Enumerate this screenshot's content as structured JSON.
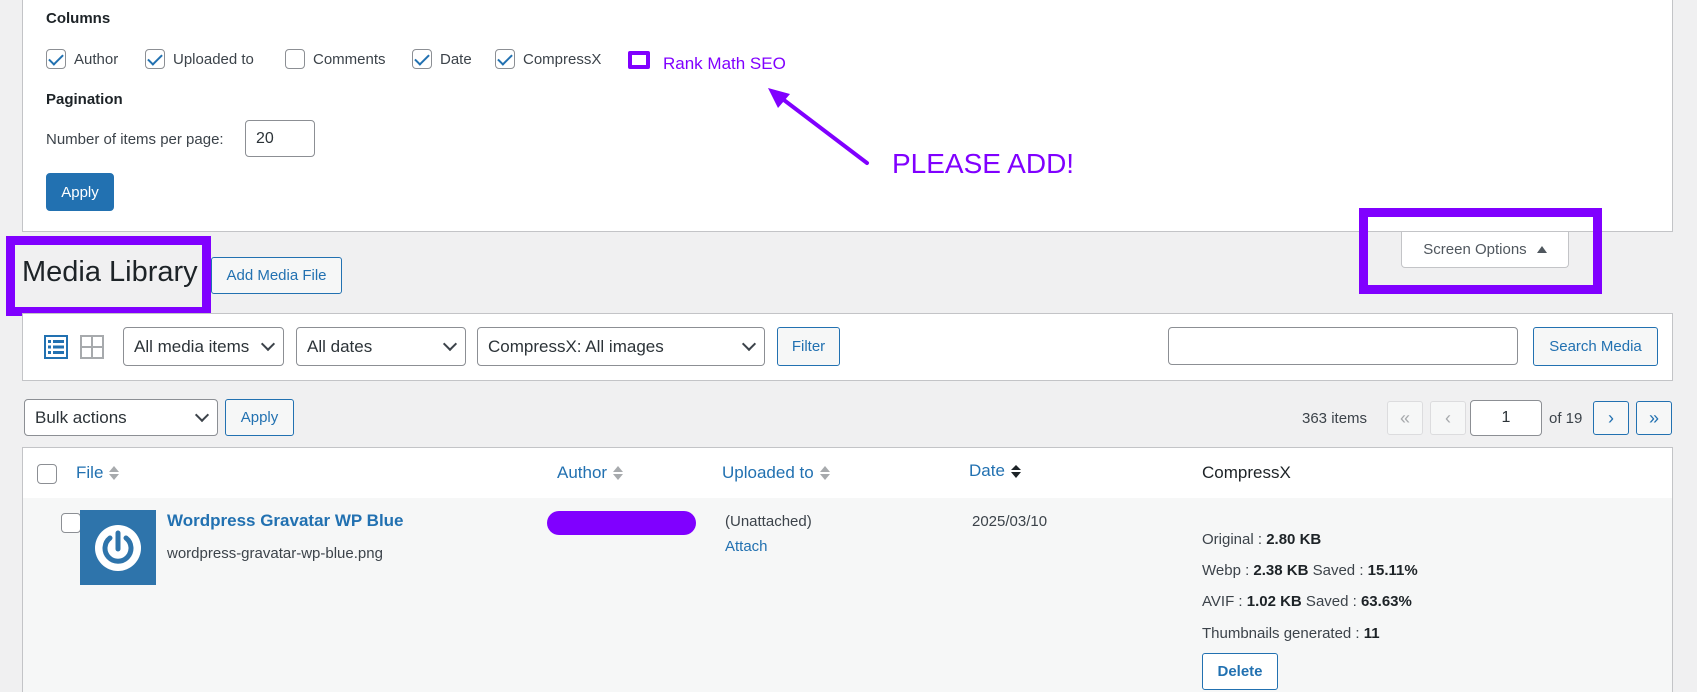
{
  "screen_options": {
    "columns_heading": "Columns",
    "columns": [
      {
        "label": "Author",
        "checked": true
      },
      {
        "label": "Uploaded to",
        "checked": true
      },
      {
        "label": "Comments",
        "checked": false
      },
      {
        "label": "Date",
        "checked": true
      },
      {
        "label": "CompressX",
        "checked": true
      }
    ],
    "rank_math_label": "Rank Math SEO",
    "pagination_heading": "Pagination",
    "items_per_page_label": "Number of items per page:",
    "items_per_page_value": "20",
    "apply_label": "Apply",
    "toggle_label": "Screen Options"
  },
  "annotation": {
    "text": "PLEASE ADD!",
    "color": "#8000ff"
  },
  "header": {
    "title": "Media Library",
    "add_button": "Add Media File"
  },
  "toolbar": {
    "view_list_icon": "list-view-icon",
    "view_grid_icon": "grid-view-icon",
    "media_filter": "All media items",
    "date_filter": "All dates",
    "compressx_filter": "CompressX: All images",
    "filter_button": "Filter",
    "search_value": "",
    "search_button": "Search Media"
  },
  "bulk": {
    "bulk_select": "Bulk actions",
    "apply_label": "Apply"
  },
  "pagination": {
    "items_count": "363 items",
    "first": "«",
    "prev": "‹",
    "current_page": "1",
    "of_total": "of 19",
    "next": "›",
    "last": "»"
  },
  "table": {
    "headers": {
      "file": "File",
      "author": "Author",
      "uploaded_to": "Uploaded to",
      "date": "Date",
      "compressx": "CompressX"
    },
    "rows": [
      {
        "title": "Wordpress Gravatar WP Blue",
        "filename": "wordpress-gravatar-wp-blue.png",
        "uploaded_to": "(Unattached)",
        "attach_label": "Attach",
        "date": "2025/03/10",
        "compressx": {
          "original_label": "Original : ",
          "original_value": "2.80 KB",
          "webp_label": "Webp : ",
          "webp_value": "2.38 KB",
          "webp_saved_label": " Saved : ",
          "webp_saved_value": "15.11%",
          "avif_label": "AVIF : ",
          "avif_value": "1.02 KB",
          "avif_saved_label": " Saved : ",
          "avif_saved_value": "63.63%",
          "thumbs_label": "Thumbnails generated : ",
          "thumbs_value": "11",
          "delete_label": "Delete"
        }
      }
    ]
  },
  "colors": {
    "accent": "#2271b1",
    "annotation": "#8000ff"
  }
}
